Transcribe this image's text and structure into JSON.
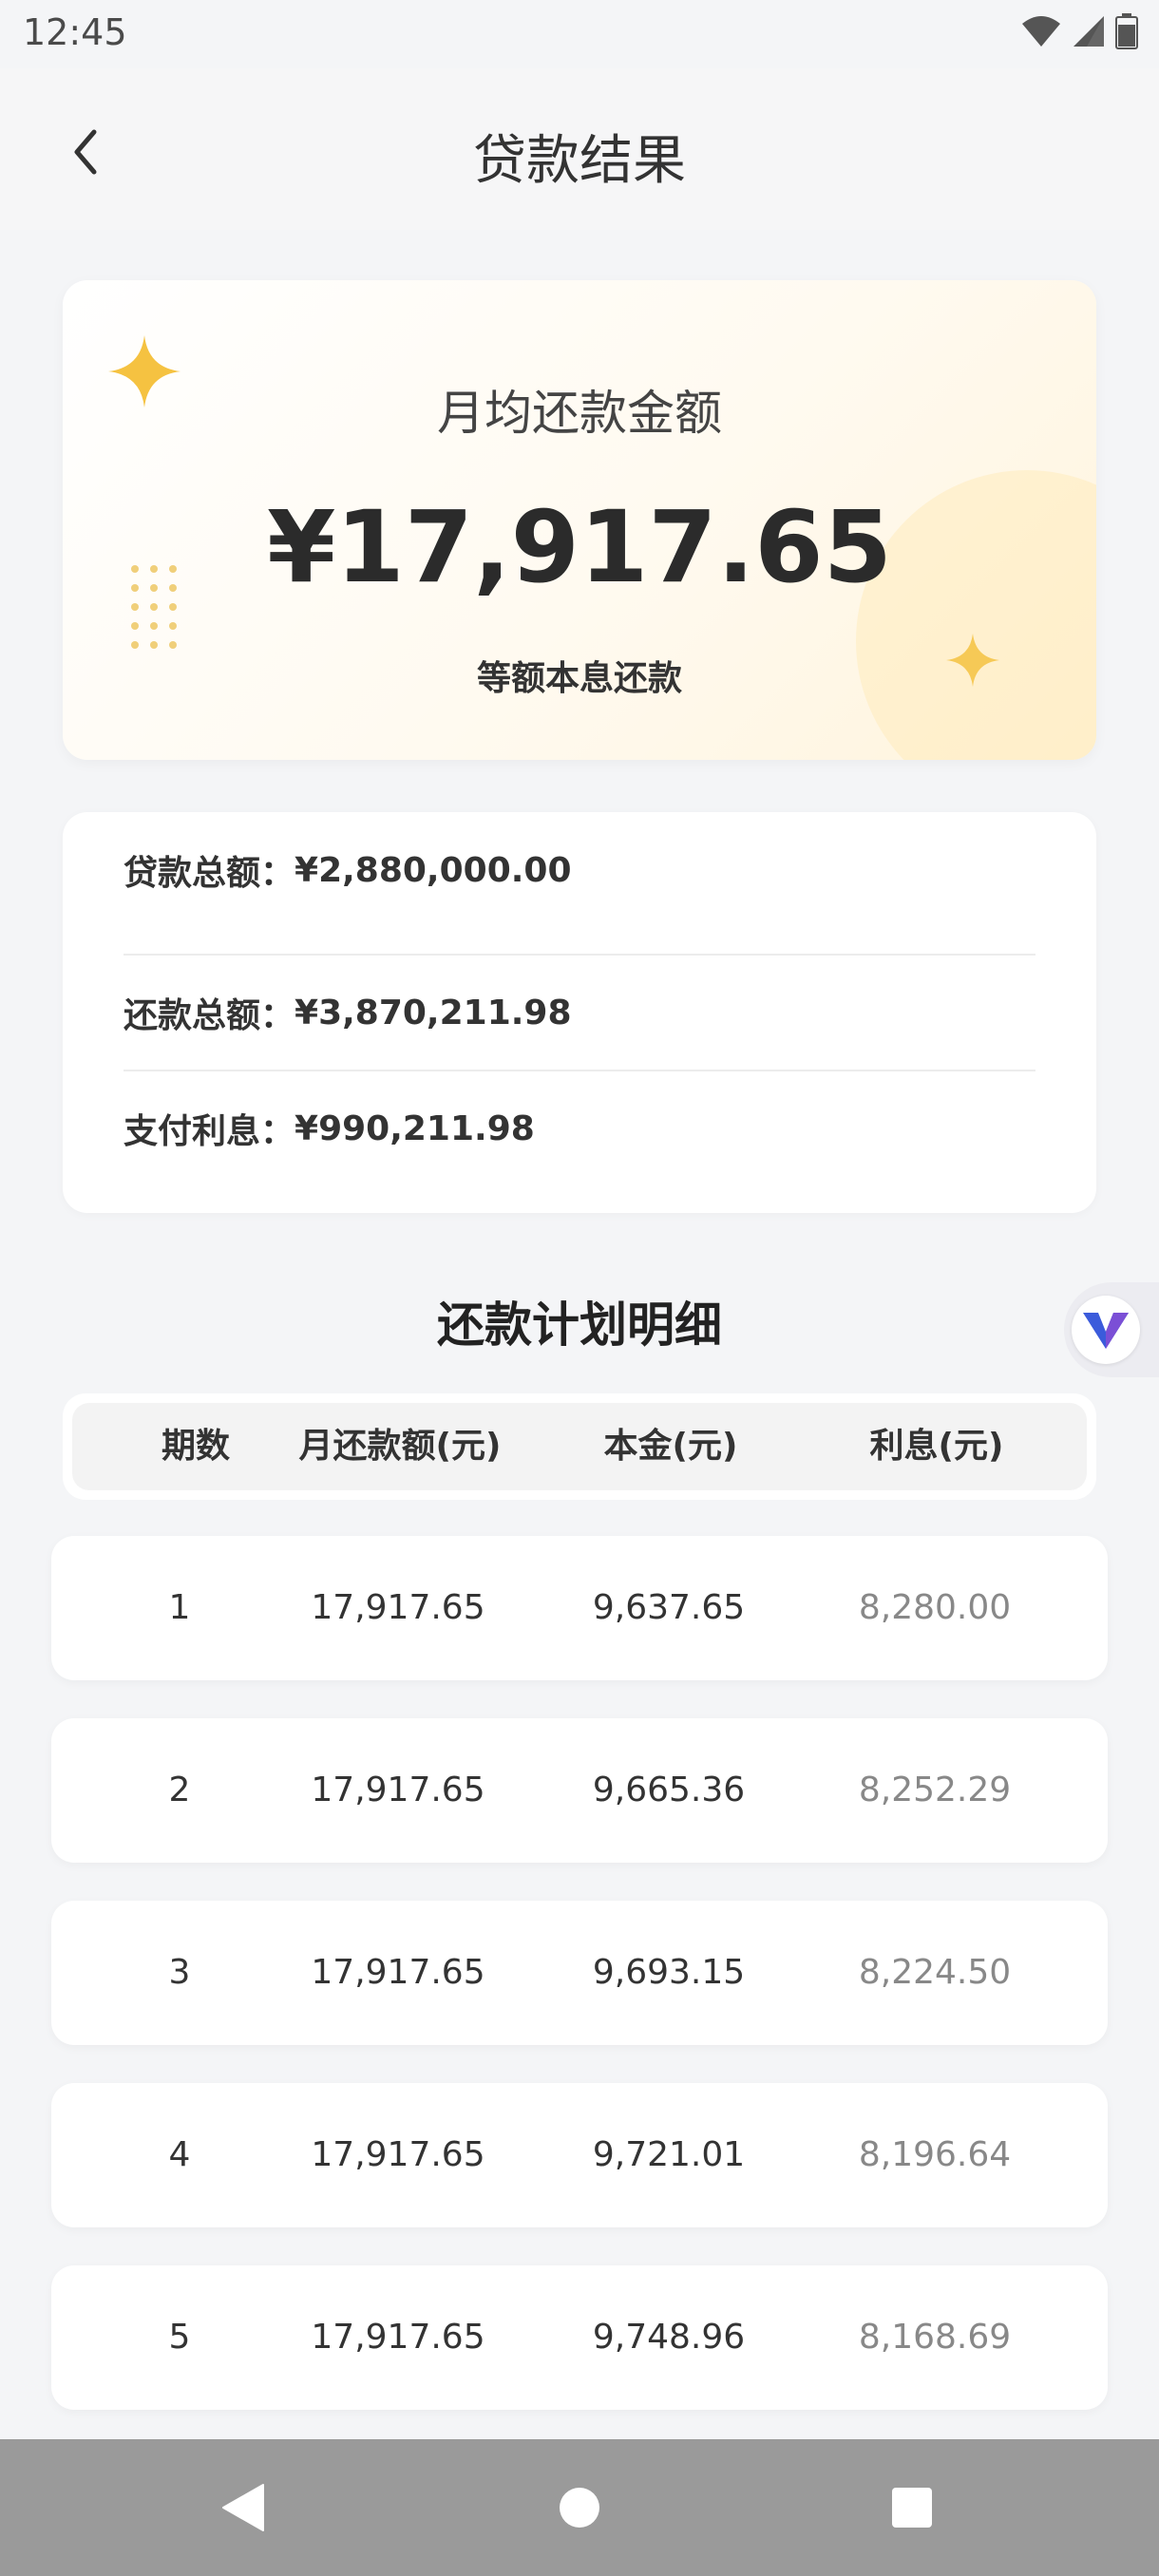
{
  "status_bar": {
    "time": "12:45"
  },
  "header": {
    "title": "贷款结果"
  },
  "hero": {
    "label": "月均还款金额",
    "amount": "¥17,917.65",
    "method": "等额本息还款"
  },
  "summary": [
    {
      "label": "贷款总额：",
      "value": "¥2,880,000.00"
    },
    {
      "label": "还款总额：",
      "value": "¥3,870,211.98"
    },
    {
      "label": "支付利息：",
      "value": "¥990,211.98"
    }
  ],
  "schedule": {
    "title": "还款计划明细",
    "columns": [
      "期数",
      "月还款额(元)",
      "本金(元)",
      "利息(元)"
    ],
    "rows": [
      {
        "period": "1",
        "payment": "17,917.65",
        "principal": "9,637.65",
        "interest": "8,280.00"
      },
      {
        "period": "2",
        "payment": "17,917.65",
        "principal": "9,665.36",
        "interest": "8,252.29"
      },
      {
        "period": "3",
        "payment": "17,917.65",
        "principal": "9,693.15",
        "interest": "8,224.50"
      },
      {
        "period": "4",
        "payment": "17,917.65",
        "principal": "9,721.01",
        "interest": "8,196.64"
      },
      {
        "period": "5",
        "payment": "17,917.65",
        "principal": "9,748.96",
        "interest": "8,168.69"
      }
    ]
  },
  "colors": {
    "accent_gold": "#f5c241",
    "interest_gray": "#888888",
    "float_icon_blue": "#3b5bdb",
    "float_icon_purple": "#7b4fd6"
  },
  "icons": {
    "back": "chevron-left-icon",
    "wifi": "wifi-icon",
    "signal": "signal-icon",
    "battery": "battery-icon",
    "float": "v-logo-icon",
    "nav_back": "triangle-back-icon",
    "nav_home": "circle-home-icon",
    "nav_recent": "square-recent-icon"
  }
}
